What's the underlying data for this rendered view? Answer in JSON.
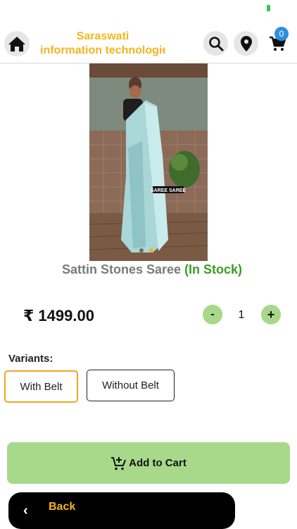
{
  "header": {
    "brand_line1": "Saraswati",
    "brand_line2": "information technologies",
    "cart_count": "0"
  },
  "product": {
    "image_caption": "SAREE SAREE",
    "title": "Sattin Stones Saree",
    "stock_status": "(In Stock)",
    "price": "₹ 1499.00",
    "quantity": "1",
    "minus_label": "-",
    "plus_label": "+"
  },
  "variants": {
    "label": "Variants:",
    "options": [
      "With Belt",
      "Without Belt"
    ],
    "selected": "With Belt"
  },
  "actions": {
    "add_to_cart": "Add to Cart",
    "back": "Back"
  },
  "colors": {
    "brand_yellow": "#f2b51f",
    "green_button": "#a8d88a",
    "stock_green": "#3a9d23",
    "badge_blue": "#2e8ee0"
  }
}
